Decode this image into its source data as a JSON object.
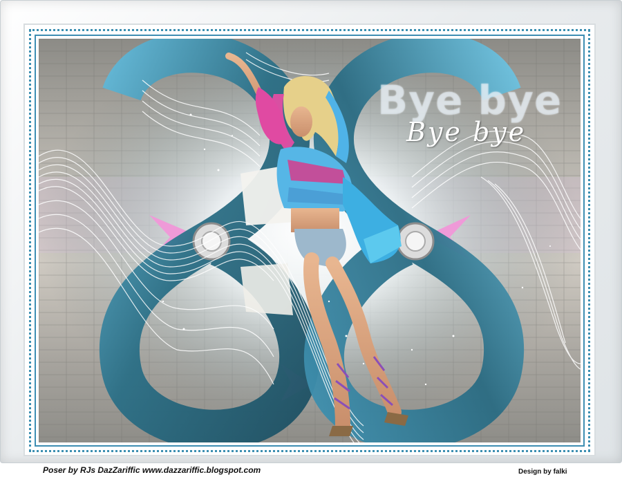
{
  "artwork": {
    "title": "Bye bye",
    "subtitle": "Bye bye"
  },
  "credits": {
    "poser": "Poser by RJs DazZariffic www.dazzariffic.blogspot.com",
    "design": "Design by falki"
  },
  "colors": {
    "frame_blue": "#3d8db2",
    "ribbon_teal": "#2c6a80",
    "accent_pink": "#ee9ad6",
    "background_grey": "#b7b4ad"
  }
}
